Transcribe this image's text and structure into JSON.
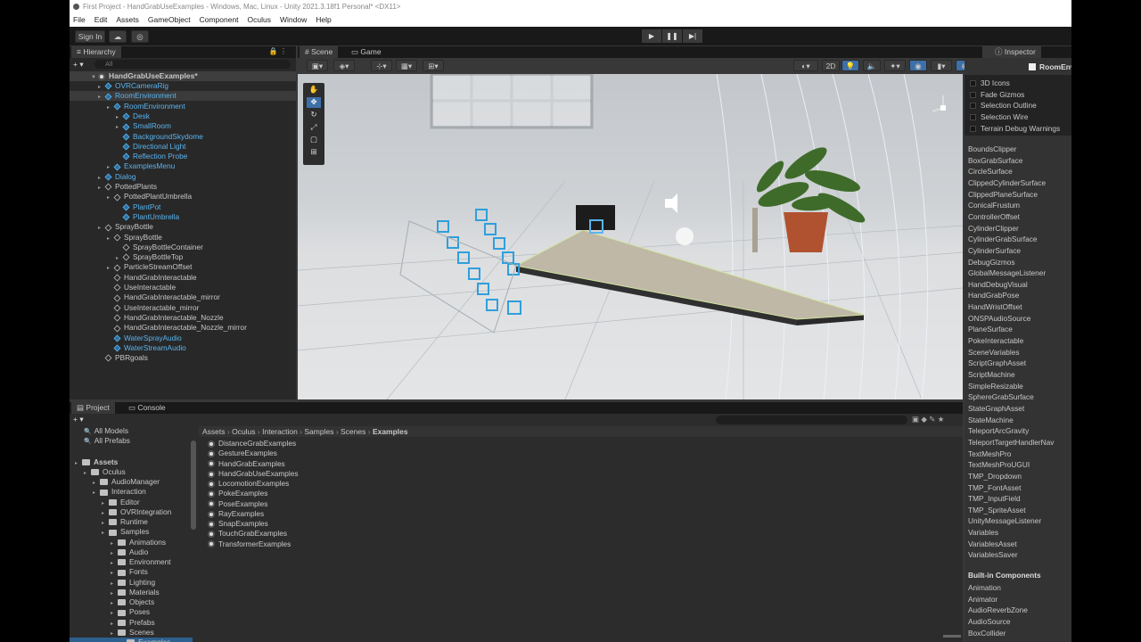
{
  "window": {
    "title": "First Project - HandGrabUseExamples - Windows, Mac, Linux - Unity 2021.3.18f1 Personal* <DX11>"
  },
  "menu": [
    "File",
    "Edit",
    "Assets",
    "GameObject",
    "Component",
    "Oculus",
    "Window",
    "Help"
  ],
  "toolbar": {
    "sign_in": "Sign In"
  },
  "hierarchy": {
    "tab": "Hierarchy",
    "search_placeholder": "All",
    "scene": "HandGrabUseExamples*",
    "items": [
      {
        "label": "OVRCameraRig",
        "blue": true
      },
      {
        "label": "RoomEnvironment",
        "blue": true
      },
      {
        "label": "RoomEnvironment",
        "blue": true
      },
      {
        "label": "Desk",
        "blue": true
      },
      {
        "label": "SmallRoom",
        "blue": true
      },
      {
        "label": "BackgroundSkydome",
        "blue": true
      },
      {
        "label": "Directional Light",
        "blue": true
      },
      {
        "label": "Reflection Probe",
        "blue": true
      },
      {
        "label": "ExamplesMenu",
        "blue": true
      },
      {
        "label": "Dialog",
        "blue": true
      },
      {
        "label": "PottedPlants",
        "blue": false
      },
      {
        "label": "PottedPlantUmbrella",
        "blue": false
      },
      {
        "label": "PlantPot",
        "blue": true
      },
      {
        "label": "PlantUmbrella",
        "blue": true
      },
      {
        "label": "SprayBottle",
        "blue": false
      },
      {
        "label": "SprayBottle",
        "blue": false
      },
      {
        "label": "SprayBottleContainer",
        "blue": false
      },
      {
        "label": "SprayBottleTop",
        "blue": false
      },
      {
        "label": "ParticleStreamOffset",
        "blue": false
      },
      {
        "label": "HandGrabInteractable",
        "blue": false
      },
      {
        "label": "UseInteractable",
        "blue": false
      },
      {
        "label": "HandGrabInteractable_mirror",
        "blue": false
      },
      {
        "label": "UseInteractable_mirror",
        "blue": false
      },
      {
        "label": "HandGrabInteractable_Nozzle",
        "blue": false
      },
      {
        "label": "HandGrabInteractable_Nozzle_mirror",
        "blue": false
      },
      {
        "label": "WaterSprayAudio",
        "blue": true
      },
      {
        "label": "WaterStreamAudio",
        "blue": true
      },
      {
        "label": "PBRgoals",
        "blue": false
      }
    ]
  },
  "scene_tabs": {
    "scene": "Scene",
    "game": "Game",
    "mode_2d": "2D"
  },
  "inspector": {
    "tab": "Inspector",
    "object_name": "RoomEnvir",
    "gizmo_menu": [
      "3D Icons",
      "Fade Gizmos",
      "Selection Outline",
      "Selection Wire",
      "Terrain Debug Warnings"
    ],
    "scripts": [
      "BoundsClipper",
      "BoxGrabSurface",
      "CircleSurface",
      "ClippedCylinderSurface",
      "ClippedPlaneSurface",
      "ConicalFrustum",
      "ControllerOffset",
      "CylinderClipper",
      "CylinderGrabSurface",
      "CylinderSurface",
      "DebugGizmos",
      "GlobalMessageListener",
      "HandDebugVisual",
      "HandGrabPose",
      "HandWristOffset",
      "ONSPAudioSource",
      "PlaneSurface",
      "PokeInteractable",
      "SceneVariables",
      "ScriptGraphAsset",
      "ScriptMachine",
      "SimpleResizable",
      "SphereGrabSurface",
      "StateGraphAsset",
      "StateMachine",
      "TeleportArcGravity",
      "TeleportTargetHandlerNav",
      "TextMeshPro",
      "TextMeshProUGUI",
      "TMP_Dropdown",
      "TMP_FontAsset",
      "TMP_InputField",
      "TMP_SpriteAsset",
      "UnityMessageListener",
      "Variables",
      "VariablesAsset",
      "VariablesSaver"
    ],
    "builtin_header": "Built-in Components",
    "builtin": [
      "Animation",
      "Animator",
      "AudioReverbZone",
      "AudioSource",
      "BoxCollider"
    ]
  },
  "project": {
    "tab_project": "Project",
    "tab_console": "Console",
    "tree": [
      {
        "label": "All Models",
        "indent": 1,
        "type": "search"
      },
      {
        "label": "All Prefabs",
        "indent": 1,
        "type": "search"
      },
      {
        "label": "Assets",
        "indent": 0,
        "type": "folder",
        "bold": true
      },
      {
        "label": "Oculus",
        "indent": 1,
        "type": "folder"
      },
      {
        "label": "AudioManager",
        "indent": 2,
        "type": "folder"
      },
      {
        "label": "Interaction",
        "indent": 2,
        "type": "folder"
      },
      {
        "label": "Editor",
        "indent": 3,
        "type": "folder"
      },
      {
        "label": "OVRIntegration",
        "indent": 3,
        "type": "folder"
      },
      {
        "label": "Runtime",
        "indent": 3,
        "type": "folder"
      },
      {
        "label": "Samples",
        "indent": 3,
        "type": "folder"
      },
      {
        "label": "Animations",
        "indent": 4,
        "type": "folder"
      },
      {
        "label": "Audio",
        "indent": 4,
        "type": "folder"
      },
      {
        "label": "Environment",
        "indent": 4,
        "type": "folder"
      },
      {
        "label": "Fonts",
        "indent": 4,
        "type": "folder"
      },
      {
        "label": "Lighting",
        "indent": 4,
        "type": "folder"
      },
      {
        "label": "Materials",
        "indent": 4,
        "type": "folder"
      },
      {
        "label": "Objects",
        "indent": 4,
        "type": "folder"
      },
      {
        "label": "Poses",
        "indent": 4,
        "type": "folder"
      },
      {
        "label": "Prefabs",
        "indent": 4,
        "type": "folder"
      },
      {
        "label": "Scenes",
        "indent": 4,
        "type": "folder"
      },
      {
        "label": "Examples",
        "indent": 5,
        "type": "folder",
        "selected": true
      }
    ],
    "breadcrumb": [
      "Assets",
      "Oculus",
      "Interaction",
      "Samples",
      "Scenes",
      "Examples"
    ],
    "files": [
      "DistanceGrabExamples",
      "GestureExamples",
      "HandGrabExamples",
      "HandGrabUseExamples",
      "LocomotionExamples",
      "PokeExamples",
      "PoseExamples",
      "RayExamples",
      "SnapExamples",
      "TouchGrabExamples",
      "TransformerExamples"
    ]
  },
  "colors": {
    "accent_blue": "#5ab4ef",
    "panel": "#282828",
    "chrome": "#383838"
  }
}
